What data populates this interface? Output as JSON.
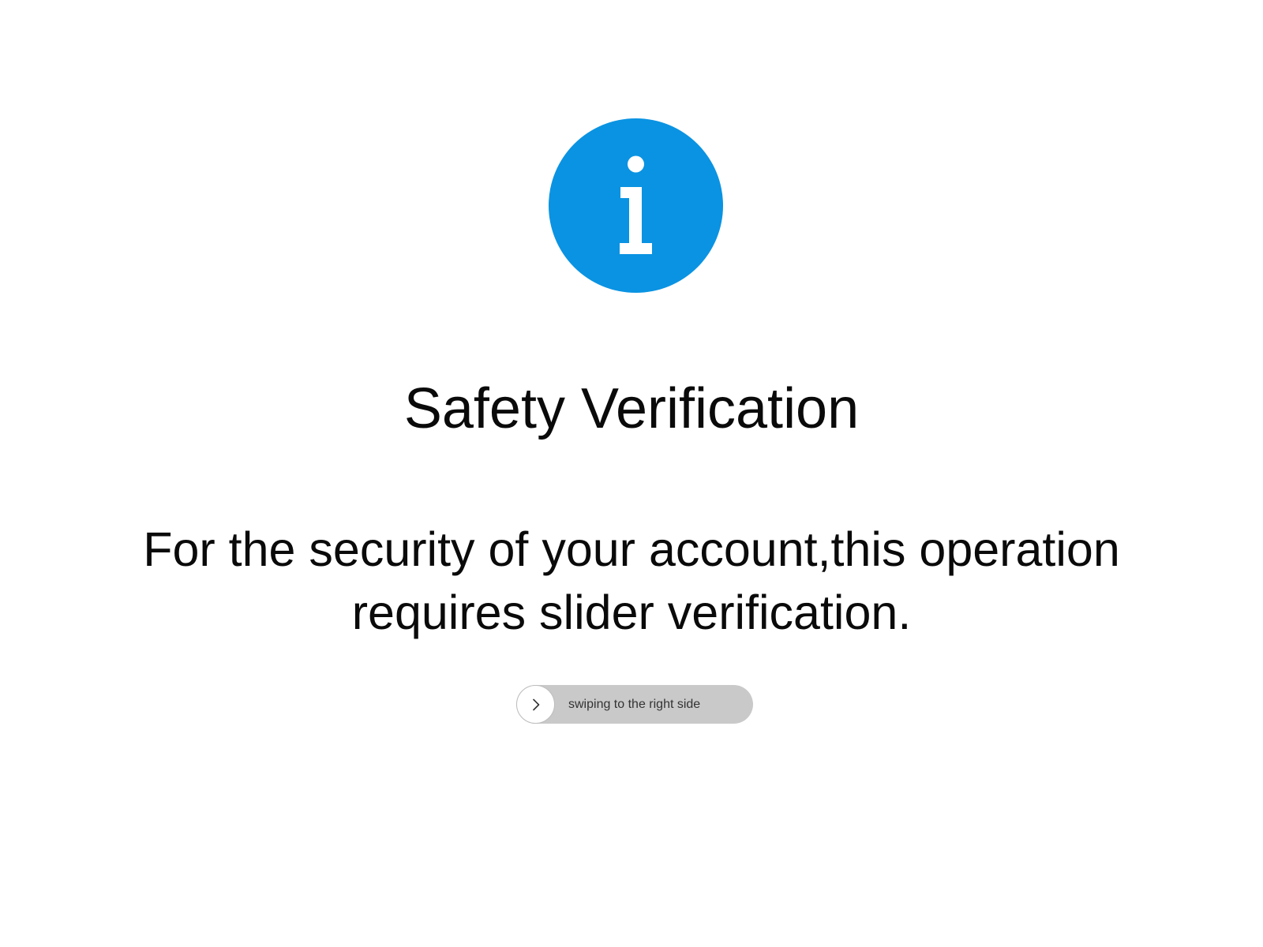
{
  "icon": {
    "name": "info-icon",
    "color": "#0a93e2",
    "glyph_color": "#ffffff"
  },
  "title": "Safety Verification",
  "message": "For the security of your account,this operation requires slider verification.",
  "slider": {
    "hint": "swiping to the right side",
    "handle_icon": "chevron-right-icon",
    "progress": 0,
    "track_color": "#c9c9c9"
  }
}
